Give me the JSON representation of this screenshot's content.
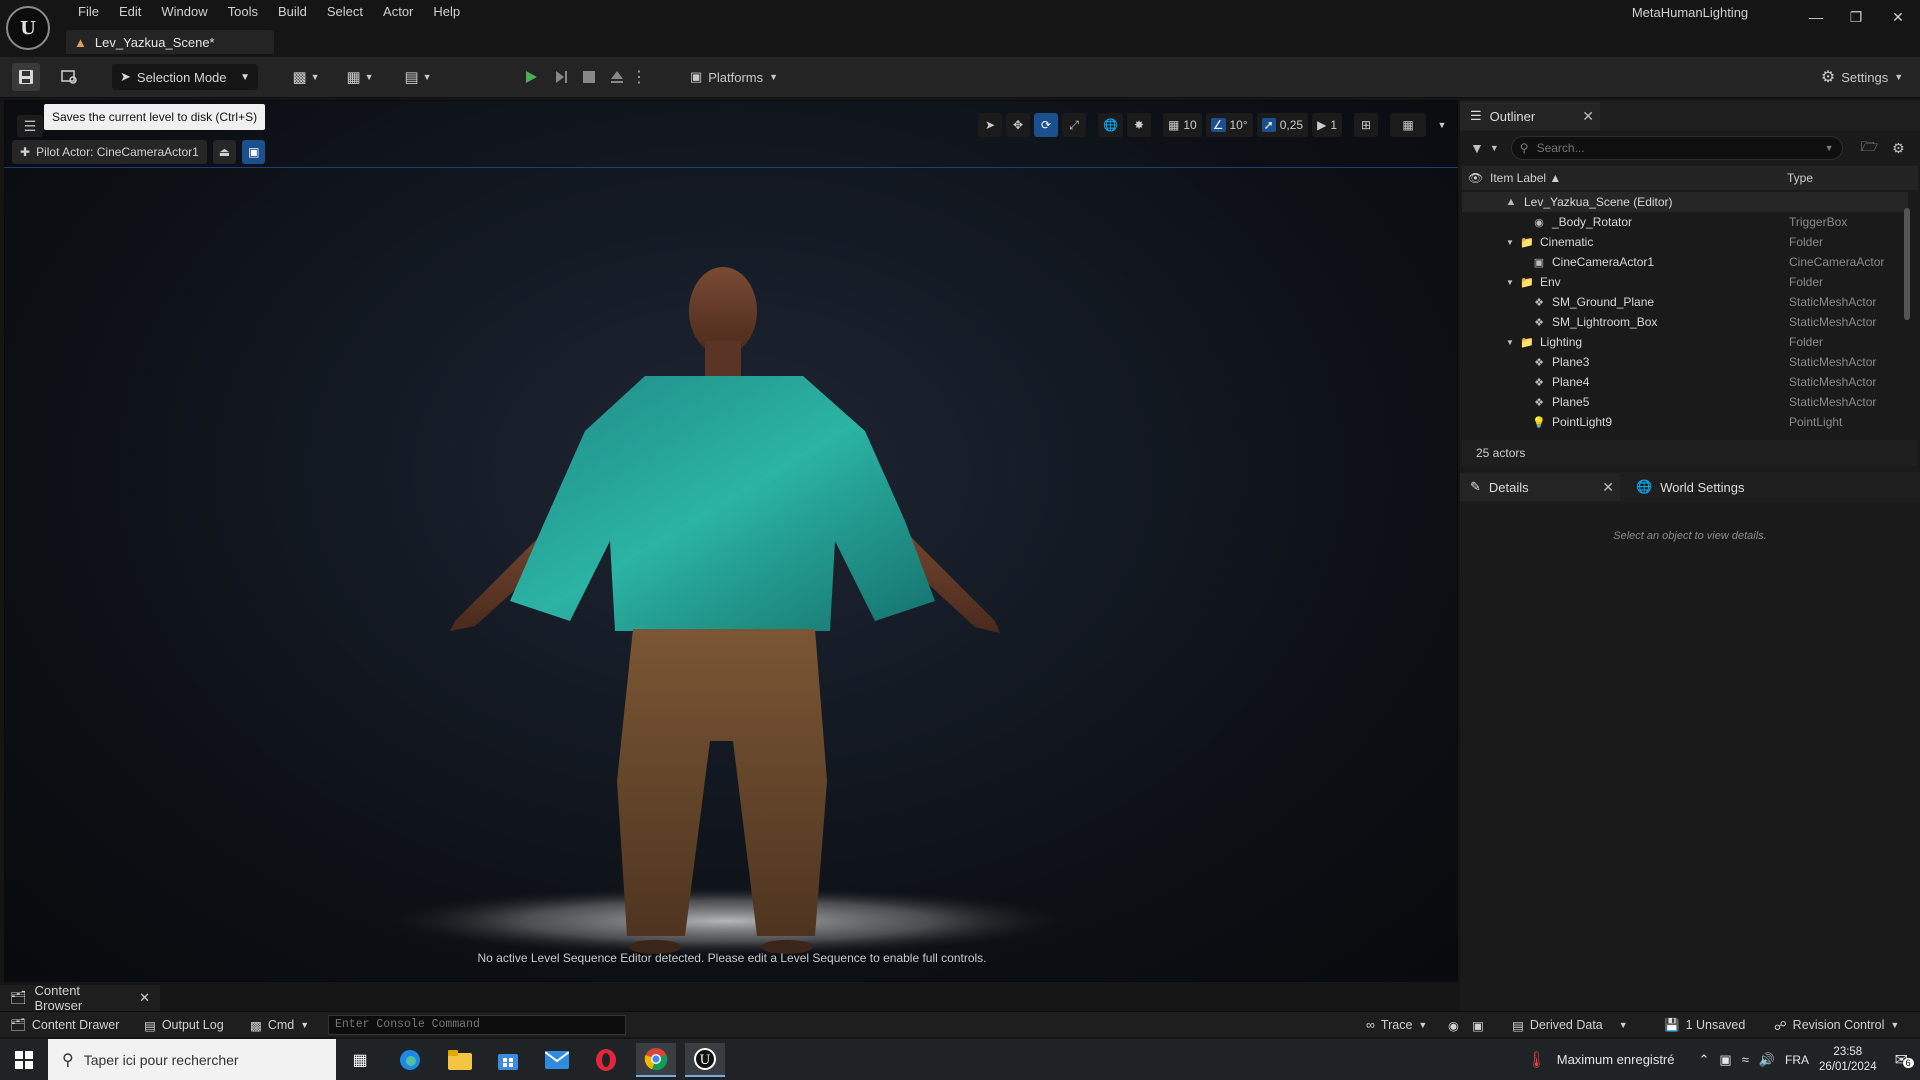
{
  "app": {
    "project_name": "MetaHumanLighting",
    "level_tab": "Lev_Yazkua_Scene*"
  },
  "menu": [
    "File",
    "Edit",
    "Window",
    "Tools",
    "Build",
    "Select",
    "Actor",
    "Help"
  ],
  "toolbar": {
    "selection_mode": "Selection Mode",
    "platforms": "Platforms",
    "settings": "Settings",
    "save_tooltip": "Saves the current level to disk (Ctrl+S)"
  },
  "viewport": {
    "pilot_actor": "Pilot Actor: CineCameraActor1",
    "grid_snap": "10",
    "rotation_snap": "10°",
    "scale_snap": "0,25",
    "camera_speed": "1",
    "message": "No active Level Sequence Editor detected. Please edit a Level Sequence to enable full controls."
  },
  "outliner": {
    "title": "Outliner",
    "search_placeholder": "Search...",
    "col_label": "Item Label ▲",
    "col_type": "Type",
    "root": "Lev_Yazkua_Scene (Editor)",
    "rows": [
      {
        "label": "_Body_Rotator",
        "type": "TriggerBox",
        "icon": "trigger-icon"
      },
      {
        "label": "Cinematic",
        "type": "Folder",
        "icon": "folder-icon"
      },
      {
        "label": "CineCameraActor1",
        "type": "CineCameraActor",
        "icon": "camera-icon"
      },
      {
        "label": "Env",
        "type": "Folder",
        "icon": "folder-icon"
      },
      {
        "label": "SM_Ground_Plane",
        "type": "StaticMeshActor",
        "icon": "mesh-icon"
      },
      {
        "label": "SM_Lightroom_Box",
        "type": "StaticMeshActor",
        "icon": "mesh-icon"
      },
      {
        "label": "Lighting",
        "type": "Folder",
        "icon": "folder-icon"
      },
      {
        "label": "Plane3",
        "type": "StaticMeshActor",
        "icon": "mesh-icon"
      },
      {
        "label": "Plane4",
        "type": "StaticMeshActor",
        "icon": "mesh-icon"
      },
      {
        "label": "Plane5",
        "type": "StaticMeshActor",
        "icon": "mesh-icon"
      },
      {
        "label": "PointLight9",
        "type": "PointLight",
        "icon": "light-icon"
      }
    ],
    "actor_count": "25 actors"
  },
  "details": {
    "tab": "Details",
    "world_settings_tab": "World Settings",
    "empty_message": "Select an object to view details."
  },
  "bottom": {
    "content_browser_tab": "Content Browser",
    "content_drawer": "Content Drawer",
    "output_log": "Output Log",
    "cmd": "Cmd",
    "console_placeholder": "Enter Console Command",
    "trace": "Trace",
    "derived_data": "Derived Data",
    "unsaved": "1 Unsaved",
    "revision_control": "Revision Control"
  },
  "taskbar": {
    "search_placeholder": "Taper ici pour rechercher",
    "weather": "Maximum enregistré",
    "language": "FRA",
    "time": "23:58",
    "date": "26/01/2024",
    "notifications": "6"
  },
  "colors": {
    "accent_blue": "#1c4f8e",
    "play_green": "#4caf50",
    "shirt_teal": "#2a9d93",
    "pants_brown": "#6b4a2b"
  }
}
